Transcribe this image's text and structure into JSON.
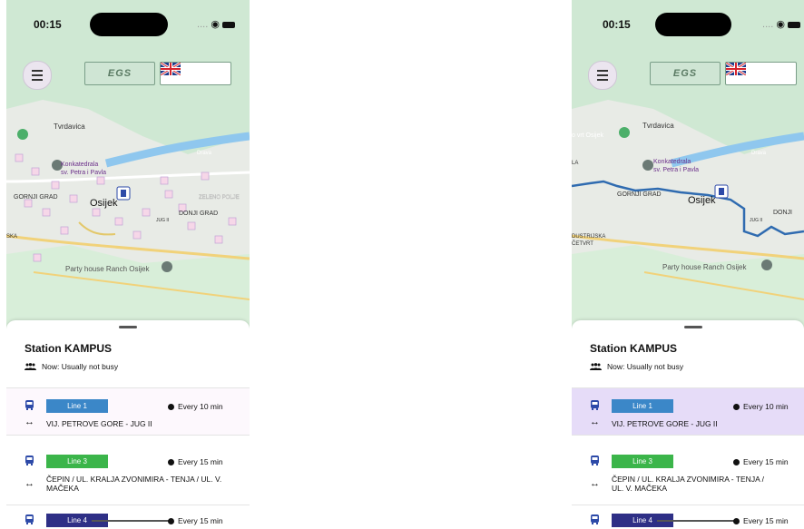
{
  "status": {
    "time": "00:15",
    "signal": "....",
    "wifi": "wifi-icon",
    "battery": "battery-icon"
  },
  "header": {
    "menu_icon": "hamburger-icon",
    "operator_label": "EGS",
    "flag_icon": "uk-flag-icon"
  },
  "map_labels": {
    "tvrdavica": "Tvrdavica",
    "konkatedrala": "Konkatedrala sv. Petra i Pavla",
    "gornji_grad": "GORNJI GRAD",
    "osijek": "Osijek",
    "zeleno_polje": "ZELENO POLJE",
    "donji_grad": "DONJI GRAD",
    "jug": "JUG II",
    "ska": "SKA",
    "party_house": "Party house Ranch Osijek",
    "drava": "Drava",
    "vrt": "o vrt Osijek",
    "la": "LA",
    "industrijska": "DUSTRIJSKA",
    "cetvrt": "ČETVRT"
  },
  "station": {
    "title": "Station KAMPUS",
    "busy": "Now: Usually not busy"
  },
  "lines": [
    {
      "badge": "Line 1",
      "color": "#3b87c8",
      "every": "Every 10 min",
      "route": "VIJ. PETROVE GORE - JUG II"
    },
    {
      "badge": "Line 3",
      "color": "#3bb54a",
      "every": "Every 15 min",
      "route": "ČEPIN / UL. KRALJA ZVONIMIRA - TENJA / UL. V. MAČEKA",
      "route_right": "ČEPIN / UL. KRALJA ZVONIMIRA - TENJA /"
    },
    {
      "badge": "Line 4",
      "color": "#2e2f86",
      "every": "Every 15 min"
    }
  ]
}
